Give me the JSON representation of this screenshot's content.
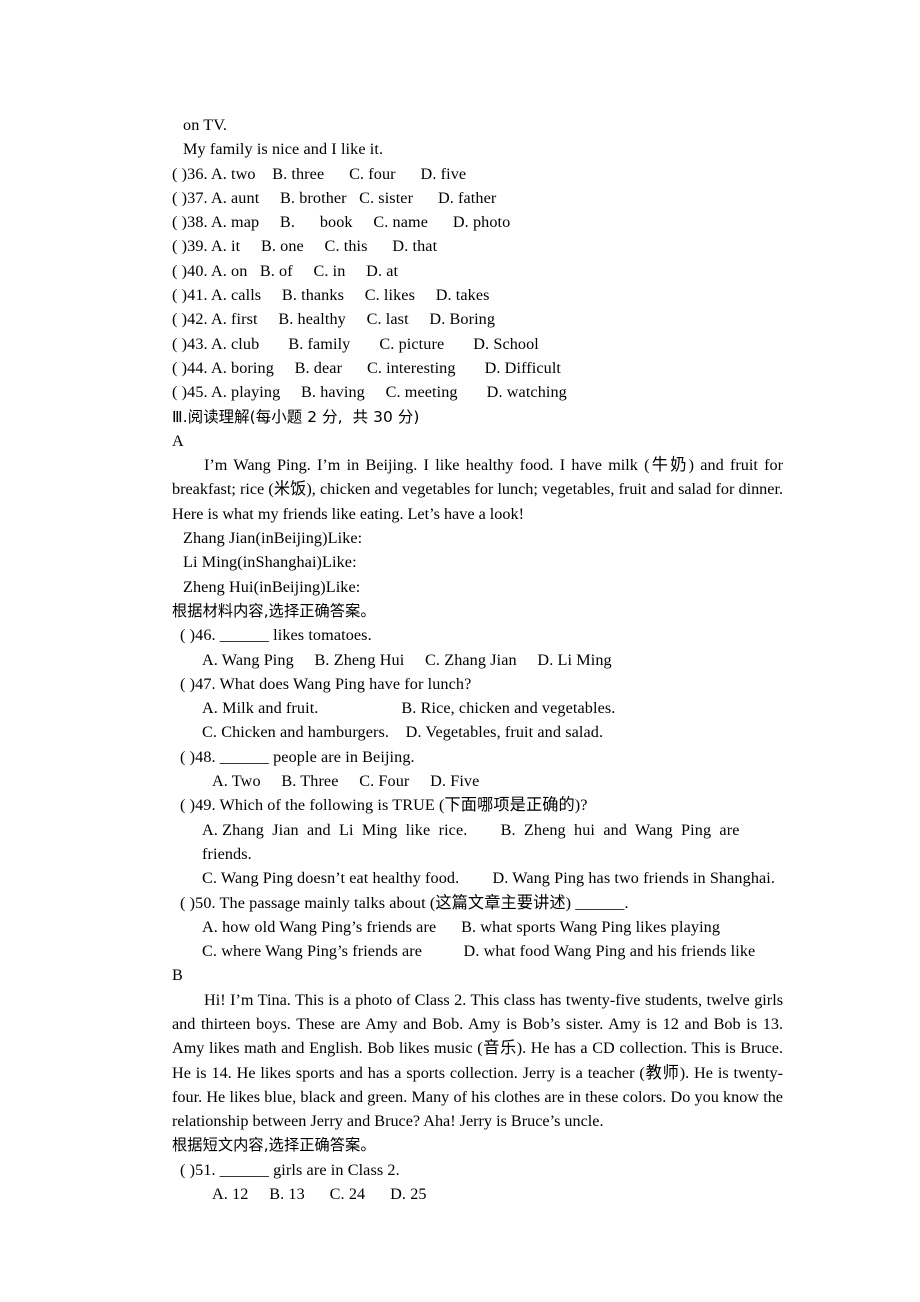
{
  "document": {
    "type": "english-exam-paper",
    "page_background": "#ffffff",
    "text_color": "#000000"
  },
  "cloze_tail": {
    "line1": "on TV.",
    "line2": "My family is nice and I like it."
  },
  "cloze_questions": [
    {
      "num": "( )36.",
      "options": "A. two    B. three      C. four      D. five"
    },
    {
      "num": "( )37.",
      "options": "A. aunt     B. brother   C. sister      D. father"
    },
    {
      "num": "( )38.",
      "options": "A. map     B.      book     C. name      D. photo"
    },
    {
      "num": "( )39.",
      "options": "A. it     B. one     C. this      D. that"
    },
    {
      "num": "( )40.",
      "options": "A. on   B. of     C. in     D. at"
    },
    {
      "num": "( )41.",
      "options": "A. calls     B. thanks     C. likes     D. takes"
    },
    {
      "num": "( )42.",
      "options": "A. first     B. healthy     C. last     D. Boring"
    },
    {
      "num": "( )43.",
      "options": "A. club       B. family       C. picture       D. School"
    },
    {
      "num": "( )44.",
      "options": "A. boring     B. dear      C. interesting       D. Difficult"
    },
    {
      "num": "( )45.",
      "options": "A. playing     B. having     C. meeting       D. watching"
    }
  ],
  "section3": {
    "heading": "Ⅲ.阅读理解(每小题 2 分,  共 30 分)",
    "passage_a": {
      "letter": "A",
      "text": "I’m Wang Ping. I’m in Beijing. I like healthy food. I have milk (牛奶) and fruit for breakfast; rice (米饭), chicken and vegetables for lunch; vegetables, fruit and salad for dinner. Here is what my friends like eating. Let’s have a look!",
      "likes": [
        "Zhang Jian(inBeijing)Like:",
        "Li Ming(inShanghai)Like:",
        "Zheng Hui(inBeijing)Like:"
      ],
      "instruction": "根据材料内容,选择正确答案。",
      "questions": [
        {
          "stem": "( )46. ______ likes tomatoes.",
          "option_lines": [
            "A. Wang Ping     B. Zheng Hui     C. Zhang Jian     D. Li Ming"
          ]
        },
        {
          "stem": "( )47. What does Wang Ping have for lunch?",
          "option_lines": [
            "A. Milk and fruit.                    B. Rice, chicken and vegetables.",
            "C. Chicken and hamburgers.    D. Vegetables, fruit and salad."
          ]
        },
        {
          "stem": "( )48. ______ people are in Beijing.",
          "option_lines": [
            "A. Two     B. Three     C. Four     D. Five"
          ]
        },
        {
          "stem": "( )49. Which of the following is TRUE (下面哪项是正确的)?",
          "option_lines": [
            "A. Zhang  Jian  and  Li  Ming  like  rice.        B.  Zheng  hui  and  Wang  Ping  are  friends.",
            "C. Wang Ping doesn’t eat healthy food.        D. Wang Ping has two friends in Shanghai."
          ]
        },
        {
          "stem": "( )50. The passage mainly talks about (这篇文章主要讲述) ______.",
          "option_lines": [
            "A. how old Wang Ping’s friends are      B. what sports Wang Ping likes playing",
            "C. where Wang Ping’s friends are          D. what food Wang Ping and his friends like"
          ]
        }
      ]
    },
    "passage_b": {
      "letter": "B",
      "text": "Hi! I’m Tina. This is a photo of Class 2. This class has twenty-five students, twelve girls and thirteen boys. These are Amy and Bob. Amy is Bob’s sister. Amy is 12 and Bob is 13. Amy likes math and English. Bob likes music (音乐). He has a CD collection. This is Bruce. He is 14. He likes sports and has a sports collection. Jerry is a teacher (教师). He is twenty-four. He likes blue, black and green. Many of his clothes are in these colors. Do you know the relationship between Jerry and Bruce? Aha! Jerry is Bruce’s uncle.",
      "instruction": "根据短文内容,选择正确答案。",
      "questions": [
        {
          "stem": "( )51. ______ girls are in Class 2.",
          "option_lines": [
            "A. 12     B. 13      C. 24      D. 25"
          ]
        }
      ]
    }
  }
}
